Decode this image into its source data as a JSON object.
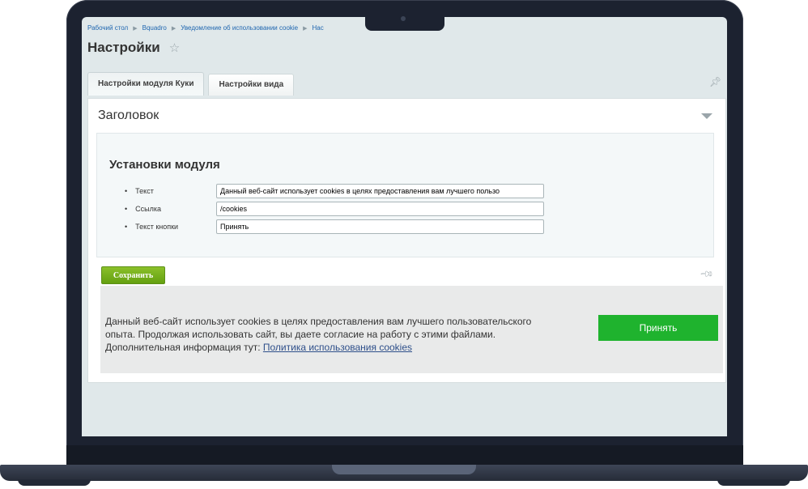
{
  "breadcrumb": {
    "items": [
      "Рабочий стол",
      "Bquadro",
      "Уведомление об использовании cookie",
      "Нас"
    ]
  },
  "page": {
    "title": "Настройки"
  },
  "tabs": [
    {
      "label": "Настройки модуля Куки",
      "active": true
    },
    {
      "label": "Настройки вида",
      "active": false
    }
  ],
  "section": {
    "title": "Заголовок"
  },
  "module": {
    "title": "Установки модуля",
    "fields": [
      {
        "label": "Текст",
        "value": "Данный веб-сайт использует cookies в целях предоставления вам лучшего пользо"
      },
      {
        "label": "Ссылка",
        "value": "/cookies"
      },
      {
        "label": "Текст кнопки",
        "value": "Принять"
      }
    ]
  },
  "actions": {
    "save_label": "Сохранить"
  },
  "preview": {
    "line1": "Данный веб-сайт использует cookies в целях предоставления вам лучшего пользовательского",
    "line2": "опыта. Продолжая использовать сайт, вы даете согласие на работу с этими файлами.",
    "line3_prefix": "Дополнительная информация тут: ",
    "link_text": "Политика использования cookies",
    "button_label": "Принять"
  },
  "icons": {
    "star": "star-icon",
    "pin": "pin-icon",
    "collapse": "chevron-down-icon",
    "breadcrumb_separator": "chevron-right-icon"
  },
  "colors": {
    "save_button": "#6aa617",
    "accept_button": "#1fb32e",
    "link": "#2067b0",
    "laptop_frame": "#1c2230"
  }
}
